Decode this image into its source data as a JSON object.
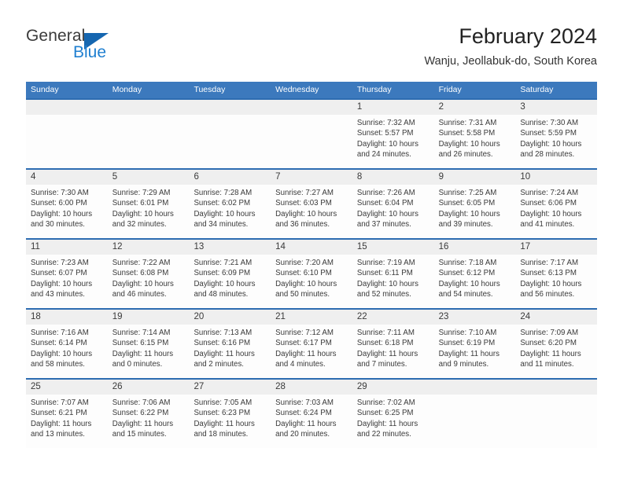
{
  "brand": {
    "word_one": "General",
    "word_two": "Blue",
    "flag_icon": "triangle-flag-icon"
  },
  "header": {
    "title": "February 2024",
    "subtitle": "Wanju, Jeollabuk-do, South Korea"
  },
  "colors": {
    "header_blue": "#3c79bd",
    "rule_blue": "#2d6cb1",
    "daynum_band": "#efefef",
    "brand_blue": "#1f7fd0",
    "flag_blue": "#1566b0",
    "text": "#3a3a3a"
  },
  "weekday_headers": [
    "Sunday",
    "Monday",
    "Tuesday",
    "Wednesday",
    "Thursday",
    "Friday",
    "Saturday"
  ],
  "weeks": [
    [
      {
        "day": "",
        "lines": []
      },
      {
        "day": "",
        "lines": []
      },
      {
        "day": "",
        "lines": []
      },
      {
        "day": "",
        "lines": []
      },
      {
        "day": "1",
        "lines": [
          "Sunrise: 7:32 AM",
          "Sunset: 5:57 PM",
          "Daylight: 10 hours",
          "and 24 minutes."
        ]
      },
      {
        "day": "2",
        "lines": [
          "Sunrise: 7:31 AM",
          "Sunset: 5:58 PM",
          "Daylight: 10 hours",
          "and 26 minutes."
        ]
      },
      {
        "day": "3",
        "lines": [
          "Sunrise: 7:30 AM",
          "Sunset: 5:59 PM",
          "Daylight: 10 hours",
          "and 28 minutes."
        ]
      }
    ],
    [
      {
        "day": "4",
        "lines": [
          "Sunrise: 7:30 AM",
          "Sunset: 6:00 PM",
          "Daylight: 10 hours",
          "and 30 minutes."
        ]
      },
      {
        "day": "5",
        "lines": [
          "Sunrise: 7:29 AM",
          "Sunset: 6:01 PM",
          "Daylight: 10 hours",
          "and 32 minutes."
        ]
      },
      {
        "day": "6",
        "lines": [
          "Sunrise: 7:28 AM",
          "Sunset: 6:02 PM",
          "Daylight: 10 hours",
          "and 34 minutes."
        ]
      },
      {
        "day": "7",
        "lines": [
          "Sunrise: 7:27 AM",
          "Sunset: 6:03 PM",
          "Daylight: 10 hours",
          "and 36 minutes."
        ]
      },
      {
        "day": "8",
        "lines": [
          "Sunrise: 7:26 AM",
          "Sunset: 6:04 PM",
          "Daylight: 10 hours",
          "and 37 minutes."
        ]
      },
      {
        "day": "9",
        "lines": [
          "Sunrise: 7:25 AM",
          "Sunset: 6:05 PM",
          "Daylight: 10 hours",
          "and 39 minutes."
        ]
      },
      {
        "day": "10",
        "lines": [
          "Sunrise: 7:24 AM",
          "Sunset: 6:06 PM",
          "Daylight: 10 hours",
          "and 41 minutes."
        ]
      }
    ],
    [
      {
        "day": "11",
        "lines": [
          "Sunrise: 7:23 AM",
          "Sunset: 6:07 PM",
          "Daylight: 10 hours",
          "and 43 minutes."
        ]
      },
      {
        "day": "12",
        "lines": [
          "Sunrise: 7:22 AM",
          "Sunset: 6:08 PM",
          "Daylight: 10 hours",
          "and 46 minutes."
        ]
      },
      {
        "day": "13",
        "lines": [
          "Sunrise: 7:21 AM",
          "Sunset: 6:09 PM",
          "Daylight: 10 hours",
          "and 48 minutes."
        ]
      },
      {
        "day": "14",
        "lines": [
          "Sunrise: 7:20 AM",
          "Sunset: 6:10 PM",
          "Daylight: 10 hours",
          "and 50 minutes."
        ]
      },
      {
        "day": "15",
        "lines": [
          "Sunrise: 7:19 AM",
          "Sunset: 6:11 PM",
          "Daylight: 10 hours",
          "and 52 minutes."
        ]
      },
      {
        "day": "16",
        "lines": [
          "Sunrise: 7:18 AM",
          "Sunset: 6:12 PM",
          "Daylight: 10 hours",
          "and 54 minutes."
        ]
      },
      {
        "day": "17",
        "lines": [
          "Sunrise: 7:17 AM",
          "Sunset: 6:13 PM",
          "Daylight: 10 hours",
          "and 56 minutes."
        ]
      }
    ],
    [
      {
        "day": "18",
        "lines": [
          "Sunrise: 7:16 AM",
          "Sunset: 6:14 PM",
          "Daylight: 10 hours",
          "and 58 minutes."
        ]
      },
      {
        "day": "19",
        "lines": [
          "Sunrise: 7:14 AM",
          "Sunset: 6:15 PM",
          "Daylight: 11 hours",
          "and 0 minutes."
        ]
      },
      {
        "day": "20",
        "lines": [
          "Sunrise: 7:13 AM",
          "Sunset: 6:16 PM",
          "Daylight: 11 hours",
          "and 2 minutes."
        ]
      },
      {
        "day": "21",
        "lines": [
          "Sunrise: 7:12 AM",
          "Sunset: 6:17 PM",
          "Daylight: 11 hours",
          "and 4 minutes."
        ]
      },
      {
        "day": "22",
        "lines": [
          "Sunrise: 7:11 AM",
          "Sunset: 6:18 PM",
          "Daylight: 11 hours",
          "and 7 minutes."
        ]
      },
      {
        "day": "23",
        "lines": [
          "Sunrise: 7:10 AM",
          "Sunset: 6:19 PM",
          "Daylight: 11 hours",
          "and 9 minutes."
        ]
      },
      {
        "day": "24",
        "lines": [
          "Sunrise: 7:09 AM",
          "Sunset: 6:20 PM",
          "Daylight: 11 hours",
          "and 11 minutes."
        ]
      }
    ],
    [
      {
        "day": "25",
        "lines": [
          "Sunrise: 7:07 AM",
          "Sunset: 6:21 PM",
          "Daylight: 11 hours",
          "and 13 minutes."
        ]
      },
      {
        "day": "26",
        "lines": [
          "Sunrise: 7:06 AM",
          "Sunset: 6:22 PM",
          "Daylight: 11 hours",
          "and 15 minutes."
        ]
      },
      {
        "day": "27",
        "lines": [
          "Sunrise: 7:05 AM",
          "Sunset: 6:23 PM",
          "Daylight: 11 hours",
          "and 18 minutes."
        ]
      },
      {
        "day": "28",
        "lines": [
          "Sunrise: 7:03 AM",
          "Sunset: 6:24 PM",
          "Daylight: 11 hours",
          "and 20 minutes."
        ]
      },
      {
        "day": "29",
        "lines": [
          "Sunrise: 7:02 AM",
          "Sunset: 6:25 PM",
          "Daylight: 11 hours",
          "and 22 minutes."
        ]
      },
      {
        "day": "",
        "lines": []
      },
      {
        "day": "",
        "lines": []
      }
    ]
  ]
}
